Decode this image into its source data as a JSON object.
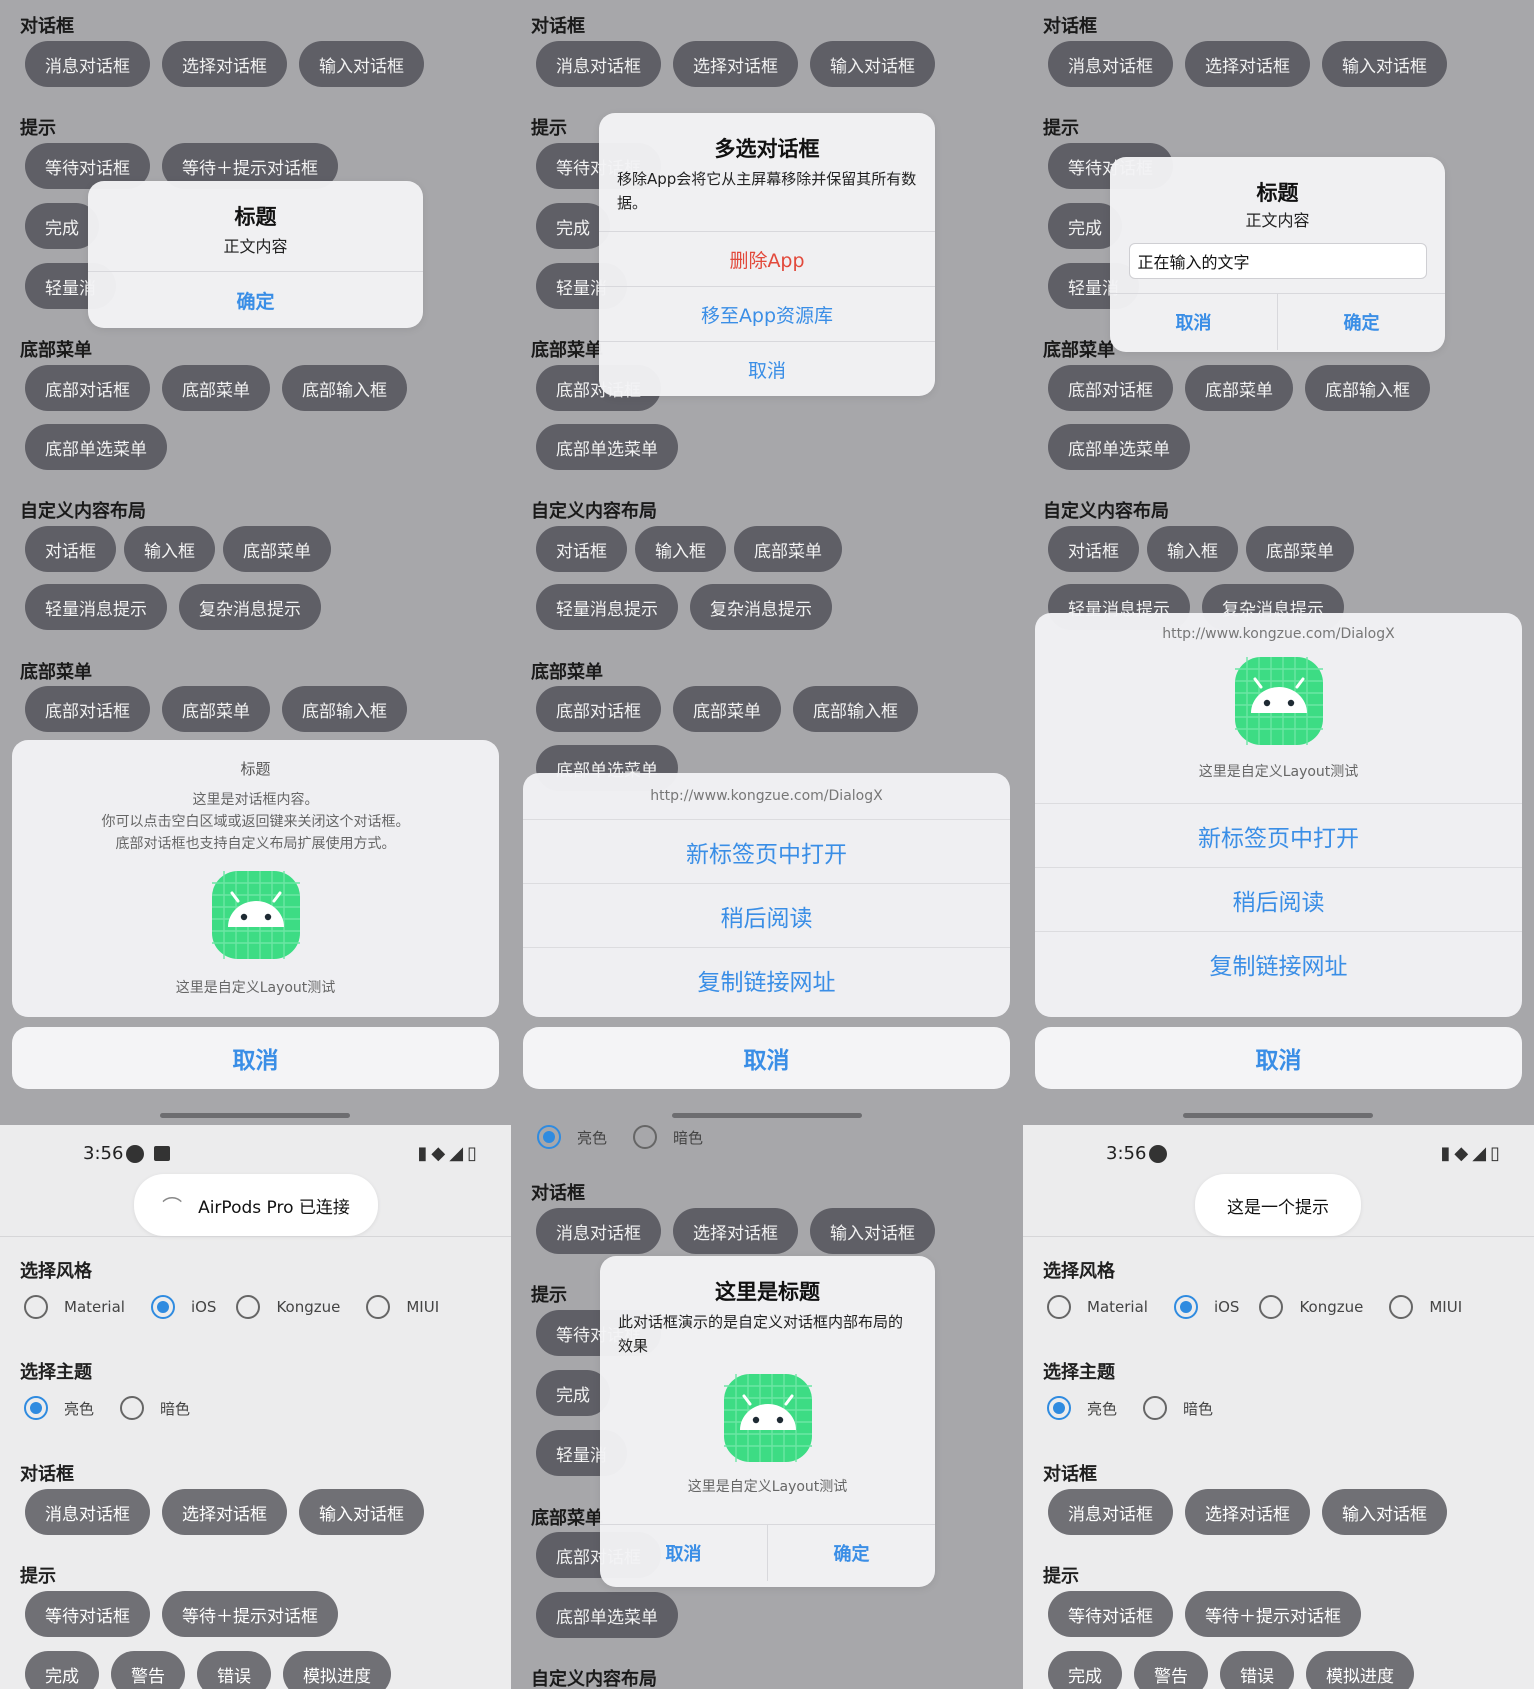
{
  "sections": {
    "dialog": "对话框",
    "tip": "提示",
    "bottom_menu": "底部菜单",
    "custom_layout": "自定义内容布局",
    "choose_style": "选择风格",
    "choose_theme": "选择主题"
  },
  "buttons": {
    "msg_dialog": "消息对话框",
    "select_dialog": "选择对话框",
    "input_dialog": "输入对话框",
    "wait_dialog": "等待对话框",
    "wait_tip_dialog": "等待＋提示对话框",
    "done": "完成",
    "warn": "警告",
    "error": "错误",
    "progress": "模拟进度",
    "light_partial": "轻量消",
    "bottom_dialog": "底部对话框",
    "bottom_menu": "底部菜单",
    "bottom_input": "底部输入框",
    "bottom_single": "底部单选菜单",
    "dialog": "对话框",
    "input": "输入框",
    "light_tip": "轻量消息提示",
    "complex_tip": "复杂消息提示"
  },
  "style_options": [
    "Material",
    "iOS",
    "Kongzue",
    "MIUI"
  ],
  "theme_options": [
    "亮色",
    "暗色"
  ],
  "msg_dialog": {
    "title": "标题",
    "body": "正文内容",
    "ok": "确定"
  },
  "multi_dialog": {
    "title": "多选对话框",
    "body": "移除App会将它从主屏幕移除并保留其所有数据。",
    "delete": "删除App",
    "move": "移至App资源库",
    "cancel": "取消"
  },
  "input_dialog": {
    "title": "标题",
    "body": "正文内容",
    "value": "正在输入的文字",
    "cancel": "取消",
    "ok": "确定"
  },
  "bottom_dialog": {
    "title": "标题",
    "line1": "这里是对话框内容。",
    "line2": "你可以点击空白区域或返回键来关闭这个对话框。",
    "line3": "底部对话框也支持自定义布局扩展使用方式。",
    "caption": "这里是自定义Layout测试",
    "cancel": "取消"
  },
  "menu_sheet": {
    "url": "http://www.kongzue.com/DialogX",
    "items": [
      "新标签页中打开",
      "稍后阅读",
      "复制链接网址"
    ],
    "caption": "这里是自定义Layout测试",
    "cancel": "取消"
  },
  "status": {
    "time": "3:56"
  },
  "toast1": "AirPods Pro 已连接",
  "toast2": "这是一个提示",
  "custom_dialog": {
    "title": "这里是标题",
    "body": "此对话框演示的是自定义对话框内部布局的效果",
    "caption": "这里是自定义Layout测试",
    "cancel": "取消",
    "ok": "确定"
  },
  "colors": {
    "accent": "#3a8ee6",
    "danger": "#e2493b",
    "android_green": "#3ddc84",
    "button_dark": "#5f5f66"
  }
}
